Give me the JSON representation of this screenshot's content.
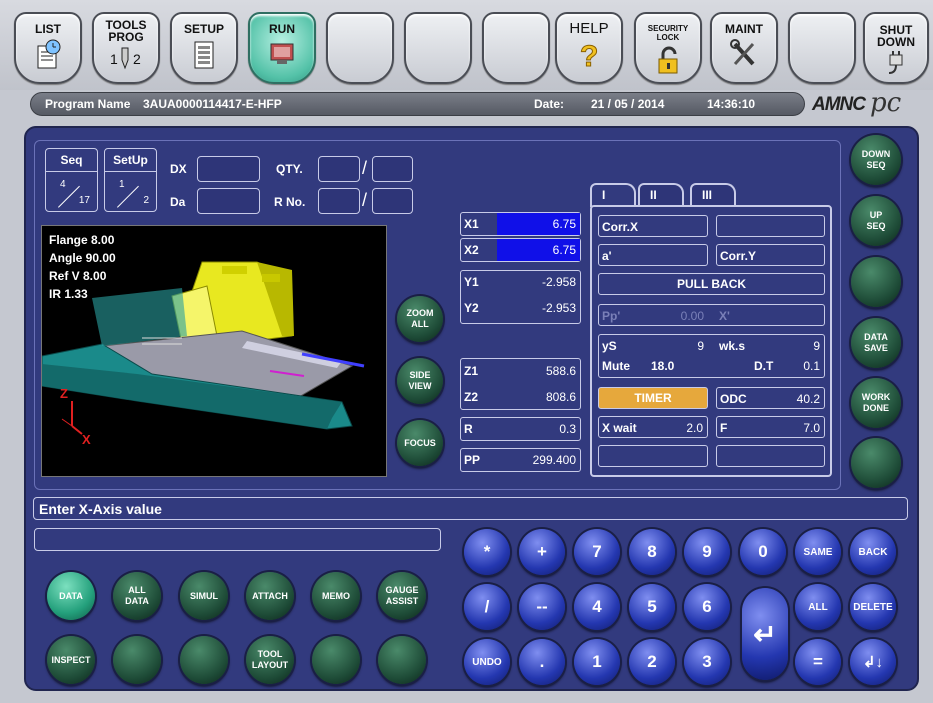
{
  "toolbar": {
    "buttons": [
      {
        "label": "LIST",
        "icon": "clock-document-icon"
      },
      {
        "label": "TOOLS\nPROG",
        "icon": "tool-12-icon"
      },
      {
        "label": "SETUP",
        "icon": "list-document-icon"
      },
      {
        "label": "RUN",
        "icon": "screen-icon",
        "active": true
      },
      {
        "label": "",
        "icon": ""
      },
      {
        "label": "",
        "icon": ""
      },
      {
        "label": "",
        "icon": ""
      },
      {
        "label": "HELP",
        "icon": "question-icon"
      },
      {
        "label": "SECURITY\nLOCK",
        "icon": "padlock-icon"
      },
      {
        "label": "MAINT",
        "icon": "wrench-screwdriver-icon"
      },
      {
        "label": "",
        "icon": ""
      },
      {
        "label": "SHUT\nDOWN",
        "icon": "plug-icon"
      }
    ]
  },
  "program_bar": {
    "program_label": "Program Name",
    "program_name": "3AUA0000114417-E-HFP",
    "date_label": "Date:",
    "date": "21 / 05 / 2014",
    "time": "14:36:10"
  },
  "logo_text": "AMNC",
  "logo_script": "pc",
  "seq": {
    "label": "Seq",
    "current": "4",
    "total": "17"
  },
  "setup": {
    "label": "SetUp",
    "current": "1",
    "total": "2"
  },
  "fields_top": {
    "dx_label": "DX",
    "da_label": "Da",
    "qty_label": "QTY.",
    "rno_label": "R No.",
    "slash": "/"
  },
  "viewport_info": {
    "line1": "Flange   8.00",
    "line2": "Angle  90.00",
    "line3": "Ref V   8.00",
    "line4": "IR   1.33",
    "axis_z": "Z",
    "axis_x": "X"
  },
  "view_buttons": {
    "zoom_all": "ZOOM\nALL",
    "side_view": "SIDE\nVIEW",
    "focus": "FOCUS"
  },
  "axes": {
    "x1": {
      "label": "X1",
      "value": "6.75"
    },
    "x2": {
      "label": "X2",
      "value": "6.75"
    },
    "y1": {
      "label": "Y1",
      "value": "-2.958"
    },
    "y2": {
      "label": "Y2",
      "value": "-2.953"
    },
    "z1": {
      "label": "Z1",
      "value": "588.6"
    },
    "z2": {
      "label": "Z2",
      "value": "808.6"
    },
    "r": {
      "label": "R",
      "value": "0.3"
    },
    "pp": {
      "label": "PP",
      "value": "299.400"
    }
  },
  "tabs": [
    "I",
    "II",
    "III"
  ],
  "params": {
    "corr_x": "Corr.X",
    "a_prime": "a'",
    "corr_y": "Corr.Y",
    "pull_back": "PULL BACK",
    "pp_label": "Pp'",
    "pp_value": "0.00",
    "x_prime": "X'",
    "ys_label": "yS",
    "ys_value": "9",
    "wks_label": "wk.s",
    "wks_value": "9",
    "mute_label": "Mute",
    "mute_value": "18.0",
    "dt_label": "D.T",
    "dt_value": "0.1",
    "timer": "TIMER",
    "odc_label": "ODC",
    "odc_value": "40.2",
    "xwait_label": "X wait",
    "xwait_value": "2.0",
    "f_label": "F",
    "f_value": "7.0"
  },
  "right_buttons": [
    "DOWN\nSEQ",
    "UP\nSEQ",
    "",
    "DATA\nSAVE",
    "WORK\nDONE",
    ""
  ],
  "message": "Enter X-Axis value",
  "bottom_buttons": {
    "row1": [
      "DATA",
      "ALL\nDATA",
      "SIMUL",
      "ATTACH",
      "MEMO",
      "GAUGE\nASSIST"
    ],
    "row2": [
      "INSPECT",
      "",
      "",
      "TOOL\nLAYOUT",
      "",
      ""
    ]
  },
  "keypad": {
    "row1": [
      "*",
      "+",
      "7",
      "8",
      "9",
      "0",
      "SAME",
      "BACK"
    ],
    "row2": [
      "/",
      "--",
      "4",
      "5",
      "6",
      "ALL",
      "DELETE"
    ],
    "row3": [
      "UNDO",
      ".",
      "1",
      "2",
      "3",
      "=",
      "↲↓"
    ],
    "enter": "↵"
  },
  "colors": {
    "panel": "#323a7e",
    "highlight_blue": "#1010e8",
    "timer": "#e6a83c",
    "model_yellow": "#e8e820",
    "model_teal": "#1a8a8a"
  }
}
